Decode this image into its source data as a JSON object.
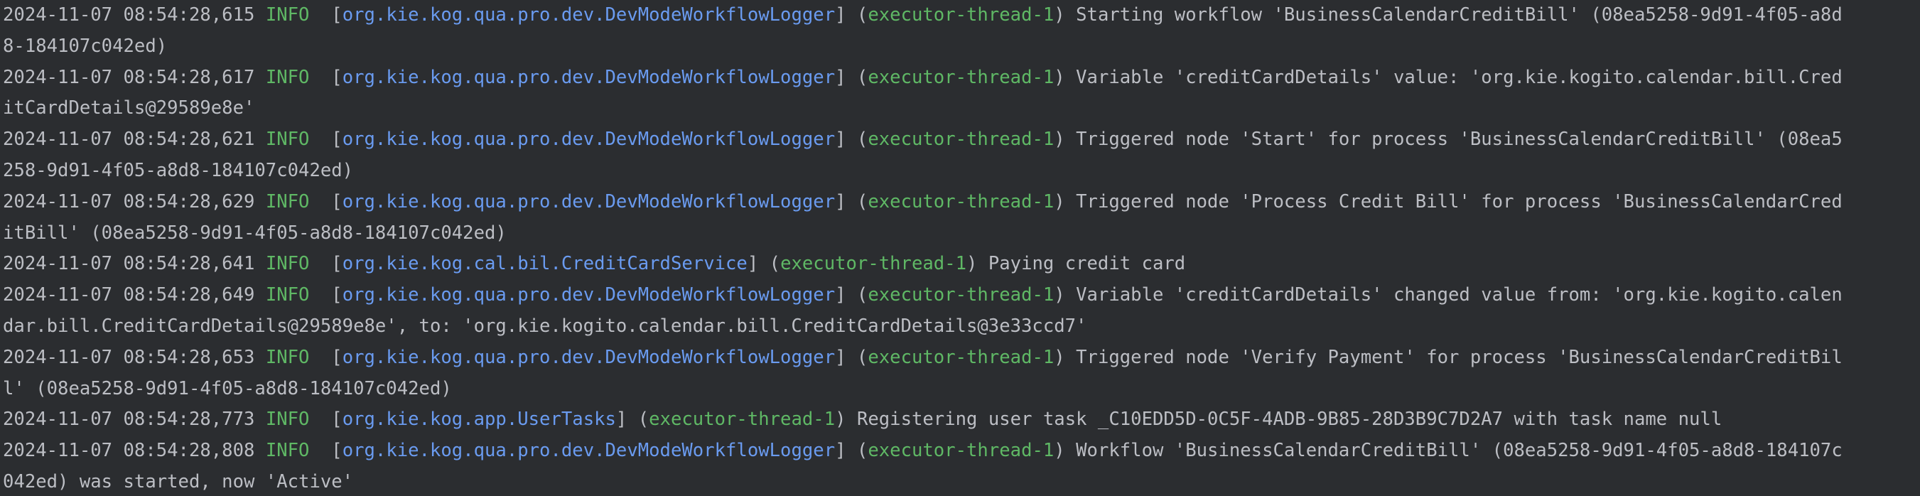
{
  "entries": [
    {
      "timestamp": "2024-11-07 08:54:28,615",
      "level": "INFO ",
      "logger": "org.kie.kog.qua.pro.dev.DevModeWorkflowLogger",
      "thread": "executor-thread-1",
      "message": "Starting workflow 'BusinessCalendarCreditBill' (08ea5258-9d91-4f05-a8d",
      "continuation": "8-184107c042ed)"
    },
    {
      "timestamp": "2024-11-07 08:54:28,617",
      "level": "INFO ",
      "logger": "org.kie.kog.qua.pro.dev.DevModeWorkflowLogger",
      "thread": "executor-thread-1",
      "message": "Variable 'creditCardDetails' value: 'org.kie.kogito.calendar.bill.Cred",
      "continuation": "itCardDetails@29589e8e'"
    },
    {
      "timestamp": "2024-11-07 08:54:28,621",
      "level": "INFO ",
      "logger": "org.kie.kog.qua.pro.dev.DevModeWorkflowLogger",
      "thread": "executor-thread-1",
      "message": "Triggered node 'Start' for process 'BusinessCalendarCreditBill' (08ea5",
      "continuation": "258-9d91-4f05-a8d8-184107c042ed)"
    },
    {
      "timestamp": "2024-11-07 08:54:28,629",
      "level": "INFO ",
      "logger": "org.kie.kog.qua.pro.dev.DevModeWorkflowLogger",
      "thread": "executor-thread-1",
      "message": "Triggered node 'Process Credit Bill' for process 'BusinessCalendarCred",
      "continuation": "itBill' (08ea5258-9d91-4f05-a8d8-184107c042ed)"
    },
    {
      "timestamp": "2024-11-07 08:54:28,641",
      "level": "INFO ",
      "logger": "org.kie.kog.cal.bil.CreditCardService",
      "thread": "executor-thread-1",
      "message": "Paying credit card",
      "continuation": ""
    },
    {
      "timestamp": "2024-11-07 08:54:28,649",
      "level": "INFO ",
      "logger": "org.kie.kog.qua.pro.dev.DevModeWorkflowLogger",
      "thread": "executor-thread-1",
      "message": "Variable 'creditCardDetails' changed value from: 'org.kie.kogito.calen",
      "continuation": "dar.bill.CreditCardDetails@29589e8e', to: 'org.kie.kogito.calendar.bill.CreditCardDetails@3e33ccd7'"
    },
    {
      "timestamp": "2024-11-07 08:54:28,653",
      "level": "INFO ",
      "logger": "org.kie.kog.qua.pro.dev.DevModeWorkflowLogger",
      "thread": "executor-thread-1",
      "message": "Triggered node 'Verify Payment' for process 'BusinessCalendarCreditBil",
      "continuation": "l' (08ea5258-9d91-4f05-a8d8-184107c042ed)"
    },
    {
      "timestamp": "2024-11-07 08:54:28,773",
      "level": "INFO ",
      "logger": "org.kie.kog.app.UserTasks",
      "thread": "executor-thread-1",
      "message": "Registering user task _C10EDD5D-0C5F-4ADB-9B85-28D3B9C7D2A7 with task name null",
      "continuation": ""
    },
    {
      "timestamp": "2024-11-07 08:54:28,808",
      "level": "INFO ",
      "logger": "org.kie.kog.qua.pro.dev.DevModeWorkflowLogger",
      "thread": "executor-thread-1",
      "message": "Workflow 'BusinessCalendarCreditBill' (08ea5258-9d91-4f05-a8d8-184107c",
      "continuation": "042ed) was started, now 'Active'"
    }
  ],
  "colors": {
    "background": "#2b2d30",
    "text": "#bcbec4",
    "level": "#5fb865",
    "logger": "#6a9bf0",
    "thread": "#5fb865"
  }
}
